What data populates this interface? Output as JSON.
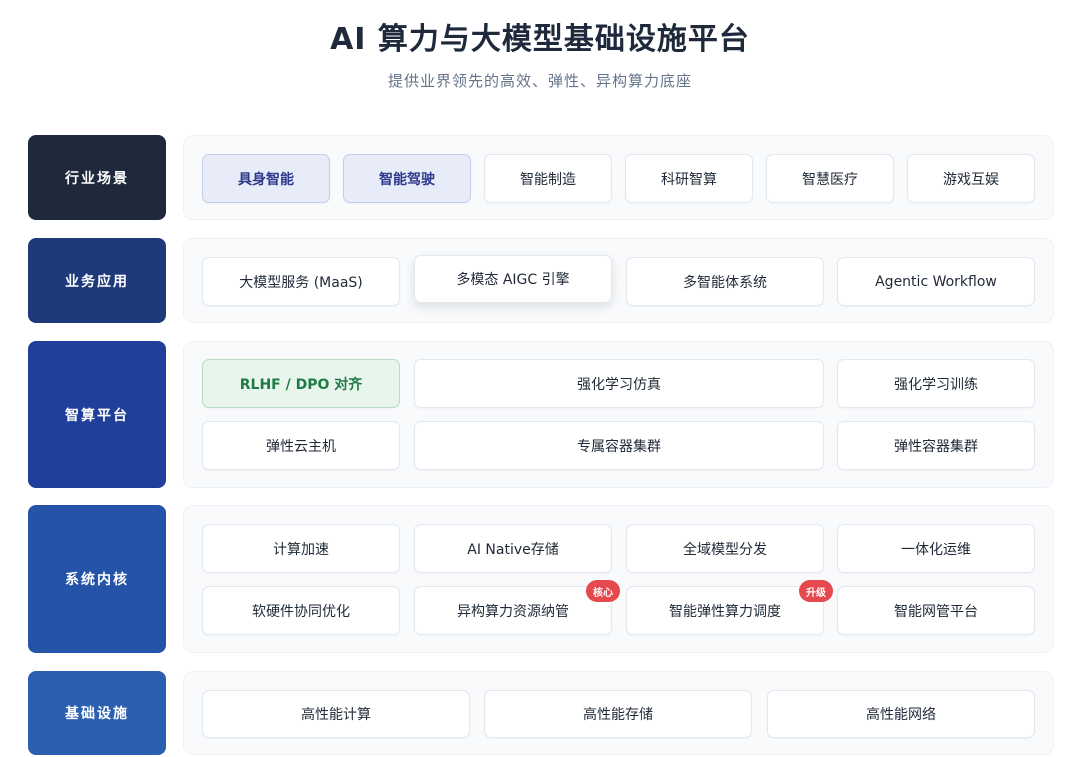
{
  "header": {
    "title": "AI 算力与大模型基础设施平台",
    "subtitle": "提供业界领先的高效、弹性、异构算力底座"
  },
  "layers": {
    "industry": {
      "label": "行业场景",
      "color": "#1e293b",
      "items": [
        "具身智能",
        "智能驾驶",
        "智能制造",
        "科研智算",
        "智慧医疗",
        "游戏互娱"
      ]
    },
    "business": {
      "label": "业务应用",
      "color": "#1e3a7a",
      "items": [
        "大模型服务 (MaaS)",
        "多模态 AIGC 引擎",
        "多智能体系统",
        "Agentic Workflow"
      ]
    },
    "platform": {
      "label": "智算平台",
      "color": "#1f3f9a",
      "items": [
        "RLHF / DPO 对齐",
        "强化学习仿真",
        "强化学习训练",
        "弹性云主机",
        "专属容器集群",
        "弹性容器集群"
      ]
    },
    "kernel": {
      "label": "系统内核",
      "color": "#2553a8",
      "items": [
        "计算加速",
        "AI Native存储",
        "全域模型分发",
        "一体化运维",
        "软硬件协同优化",
        "异构算力资源纳管",
        "智能弹性算力调度",
        "智能网管平台"
      ],
      "badges": [
        "核心",
        "升级"
      ]
    },
    "infra": {
      "label": "基础设施",
      "color": "#2c5fb0",
      "items": [
        "高性能计算",
        "高性能存储",
        "高性能网络"
      ]
    }
  },
  "colors": {
    "highlight_blue": "#e8ebf8",
    "highlight_green": "#e8f5ec",
    "badge_red": "#e5484d"
  }
}
